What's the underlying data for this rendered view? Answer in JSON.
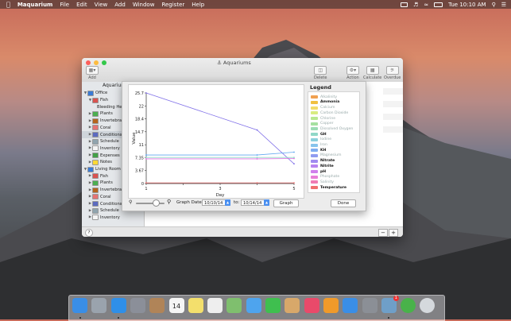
{
  "menubar": {
    "app_name": "Maquarium",
    "items": [
      "File",
      "Edit",
      "View",
      "Add",
      "Window",
      "Register",
      "Help"
    ],
    "clock": "Tue 10:10 AM"
  },
  "window": {
    "title": "Aquariums",
    "toolbar": {
      "add_label": "Add",
      "delete_label": "Delete",
      "action_label": "Action",
      "calculate_label": "Calculate",
      "overdue_label": "Overdue"
    },
    "sidebar_header": "Aquariums",
    "tree": [
      {
        "label": "Office",
        "level": 0,
        "expanded": true,
        "icon_color": "#3a7bd5"
      },
      {
        "label": "Fish",
        "level": 1,
        "expanded": true,
        "icon_color": "#d9534f"
      },
      {
        "label": "Bleeding He",
        "level": 2,
        "expanded": false,
        "icon_color": ""
      },
      {
        "label": "Plants",
        "level": 1,
        "expanded": false,
        "icon_color": "#4caf50"
      },
      {
        "label": "Invertebra",
        "level": 1,
        "expanded": false,
        "icon_color": "#b5651d"
      },
      {
        "label": "Coral",
        "level": 1,
        "expanded": false,
        "icon_color": "#e57373"
      },
      {
        "label": "Conditions",
        "level": 1,
        "expanded": false,
        "icon_color": "#5c6bc0",
        "selected": true
      },
      {
        "label": "Schedule",
        "level": 1,
        "expanded": false,
        "icon_color": "#90a4ae"
      },
      {
        "label": "Inventory",
        "level": 1,
        "expanded": false,
        "icon_color": "#f5f5f5"
      },
      {
        "label": "Expenses",
        "level": 1,
        "expanded": false,
        "icon_color": "#43a047"
      },
      {
        "label": "Notes",
        "level": 1,
        "expanded": false,
        "icon_color": "#fdd835"
      },
      {
        "label": "Living Room",
        "level": 0,
        "expanded": true,
        "icon_color": "#3a7bd5"
      },
      {
        "label": "Fish",
        "level": 1,
        "expanded": false,
        "icon_color": "#d9534f"
      },
      {
        "label": "Plants",
        "level": 1,
        "expanded": false,
        "icon_color": "#4caf50"
      },
      {
        "label": "Invertebra",
        "level": 1,
        "expanded": false,
        "icon_color": "#b5651d"
      },
      {
        "label": "Coral",
        "level": 1,
        "expanded": false,
        "icon_color": "#e57373"
      },
      {
        "label": "Conditions",
        "level": 1,
        "expanded": false,
        "icon_color": "#5c6bc0"
      },
      {
        "label": "Schedule",
        "level": 1,
        "expanded": false,
        "icon_color": "#90a4ae"
      },
      {
        "label": "Inventory",
        "level": 1,
        "expanded": false,
        "icon_color": "#f5f5f5"
      }
    ],
    "help_label": "?",
    "minus_label": "−",
    "plus_label": "+"
  },
  "sheet": {
    "legend_title": "Legend",
    "legend": [
      {
        "label": "Alkalinity",
        "color": "#f0a050",
        "on": false
      },
      {
        "label": "Ammonia",
        "color": "#f0c040",
        "on": true
      },
      {
        "label": "Calcium",
        "color": "#f2dc6a",
        "on": false
      },
      {
        "label": "Carbon Dioxide",
        "color": "#d8ec80",
        "on": false
      },
      {
        "label": "Chlorine",
        "color": "#b8e890",
        "on": false
      },
      {
        "label": "Copper",
        "color": "#a6e0a0",
        "on": false
      },
      {
        "label": "Dissolved Oxygen",
        "color": "#9cdcb4",
        "on": false
      },
      {
        "label": "GH",
        "color": "#90d8c8",
        "on": true
      },
      {
        "label": "Iodine",
        "color": "#8cd0dc",
        "on": false
      },
      {
        "label": "Iron",
        "color": "#88c4ec",
        "on": false
      },
      {
        "label": "KH",
        "color": "#80aef0",
        "on": true
      },
      {
        "label": "Magnesium",
        "color": "#909cf0",
        "on": false
      },
      {
        "label": "Nitrate",
        "color": "#a08cf0",
        "on": true
      },
      {
        "label": "Nitrite",
        "color": "#b884f0",
        "on": true
      },
      {
        "label": "pH",
        "color": "#d080ec",
        "on": true
      },
      {
        "label": "Phosphate",
        "color": "#e880d8",
        "on": false
      },
      {
        "label": "Salinity",
        "color": "#f07cb4",
        "on": false
      },
      {
        "label": "Temperature",
        "color": "#f07070",
        "on": true
      }
    ],
    "graph_date_label": "Graph Date:",
    "date_from": "10/10/14",
    "to_label": "to:",
    "date_to": "10/14/14",
    "graph_button": "Graph",
    "done_button": "Done",
    "zoom_level": 0.8
  },
  "chart_data": {
    "type": "line",
    "title": "",
    "xlabel": "Day",
    "ylabel": "Value",
    "x_ticks": [
      1,
      3,
      5
    ],
    "x_minor_ticks": [
      2,
      4
    ],
    "xlim": [
      1,
      5
    ],
    "y_ticks": [
      "0",
      "3.67",
      "7.35",
      "11",
      "14.7",
      "18.4",
      "22",
      "25.7"
    ],
    "ylim": [
      0,
      25.7
    ],
    "grid": false,
    "series": [
      {
        "color": "#8070e8",
        "x": [
          1,
          4,
          5
        ],
        "y": [
          25.7,
          15.2,
          5.6
        ]
      },
      {
        "color": "#60a8f0",
        "x": [
          1,
          4,
          5
        ],
        "y": [
          8.1,
          8.1,
          8.9
        ]
      },
      {
        "color": "#e070e0",
        "x": [
          1,
          4,
          5
        ],
        "y": [
          7.0,
          7.0,
          7.1
        ]
      },
      {
        "color": "#f07070",
        "x": [
          1,
          4,
          5
        ],
        "y": [
          0.2,
          0.2,
          0.2
        ]
      },
      {
        "color": "#90d8c8",
        "x": [
          1,
          4,
          5
        ],
        "y": [
          7.4,
          7.4,
          7.4
        ]
      }
    ]
  },
  "dock": {
    "icons": [
      {
        "name": "finder-icon",
        "color": "#3a8ee6",
        "running": true
      },
      {
        "name": "launchpad-icon",
        "color": "#9aa3ad",
        "running": false
      },
      {
        "name": "safari-icon",
        "color": "#2f8fe8",
        "running": true
      },
      {
        "name": "photo-preview-icon",
        "color": "#8b8f99",
        "running": false
      },
      {
        "name": "contacts-icon",
        "color": "#b08458",
        "running": false
      },
      {
        "name": "calendar-icon",
        "color": "#f5f5f5",
        "running": false
      },
      {
        "name": "notes-icon",
        "color": "#f3df6c",
        "running": false
      },
      {
        "name": "reminders-icon",
        "color": "#eeeeee",
        "running": false
      },
      {
        "name": "maps-icon",
        "color": "#7fbf6e",
        "running": false
      },
      {
        "name": "messages-icon",
        "color": "#4ea4ee",
        "running": false
      },
      {
        "name": "facetime-icon",
        "color": "#3fbf4f",
        "running": false
      },
      {
        "name": "photos-icon",
        "color": "#d8a86a",
        "running": false
      },
      {
        "name": "itunes-icon",
        "color": "#e94a6a",
        "running": false
      },
      {
        "name": "ibooks-icon",
        "color": "#f09a2a",
        "running": false
      },
      {
        "name": "app-store-icon",
        "color": "#3a8ee6",
        "running": false
      },
      {
        "name": "system-preferences-icon",
        "color": "#8b8f96",
        "running": false
      },
      {
        "name": "maquarium-icon",
        "color": "#6f9fc8",
        "running": true
      },
      {
        "name": "app-leaf-icon",
        "color": "#49b24a",
        "running": false
      },
      {
        "name": "trash-icon",
        "color": "#d5d9dd",
        "running": false
      }
    ],
    "calendar_day": "14",
    "badge": "1"
  }
}
